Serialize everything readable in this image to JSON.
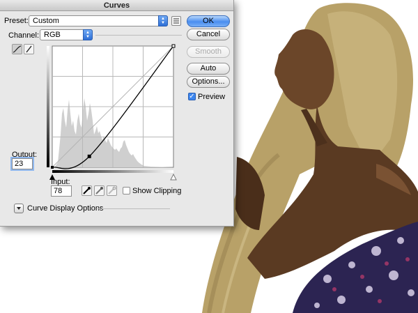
{
  "dialog": {
    "title": "Curves",
    "preset": {
      "label": "Preset:",
      "value": "Custom"
    },
    "channel": {
      "label": "Channel:",
      "value": "RGB"
    },
    "buttons": {
      "ok": "OK",
      "cancel": "Cancel",
      "smooth": "Smooth",
      "auto": "Auto",
      "options": "Options..."
    },
    "preview": {
      "label": "Preview",
      "checked": true
    },
    "output": {
      "label": "Output:",
      "value": "23"
    },
    "input": {
      "label": "Input:",
      "value": "78"
    },
    "show_clipping": {
      "label": "Show Clipping",
      "checked": false
    },
    "curve_display_options": "Curve Display Options",
    "curve_point": {
      "input": 78,
      "output": 23
    }
  },
  "colors": {
    "accent": "#3d86ee",
    "dialog_bg": "#e8e8e8"
  }
}
